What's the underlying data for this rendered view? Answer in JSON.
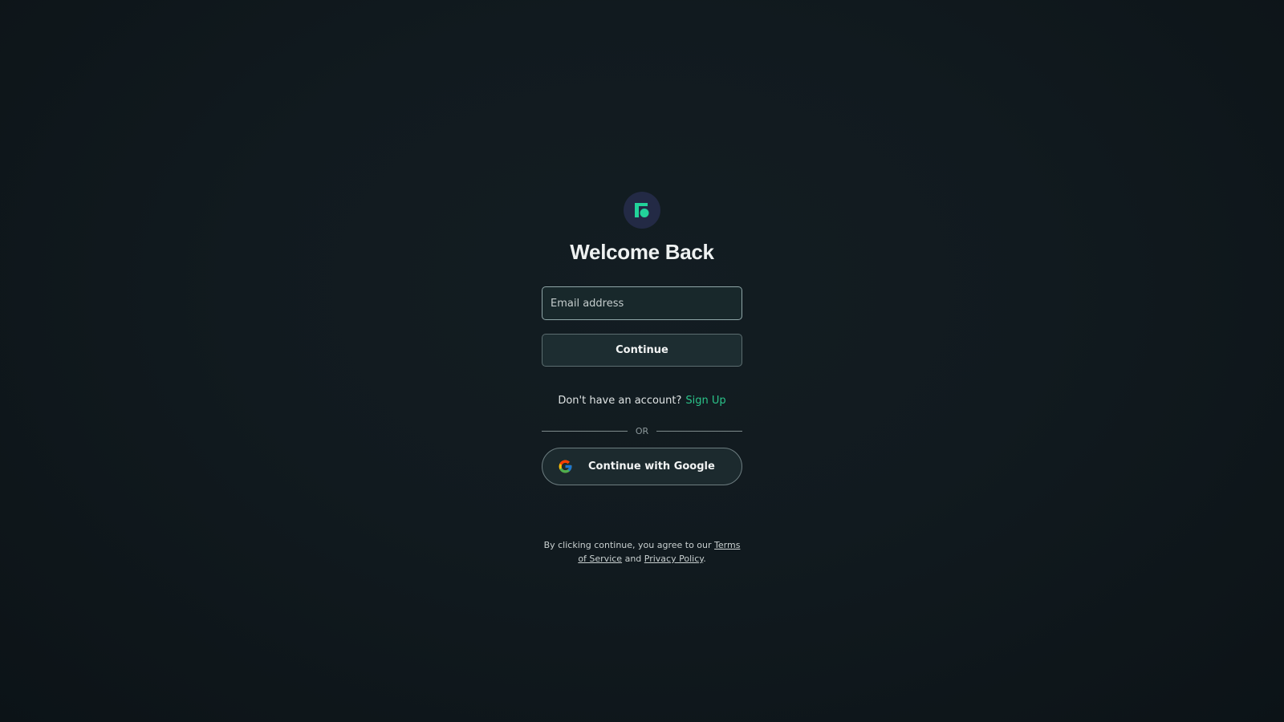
{
  "brand": {
    "logo_icon": "brand-logo-icon",
    "accent_color": "#22d39a"
  },
  "header": {
    "title": "Welcome Back"
  },
  "form": {
    "email_placeholder": "Email address",
    "email_value": "",
    "continue_label": "Continue"
  },
  "signup": {
    "prompt": "Don't have an account?",
    "link_label": "Sign Up"
  },
  "divider": {
    "label": "OR"
  },
  "oauth": {
    "google_label": "Continue with Google",
    "google_icon": "google-icon"
  },
  "legal": {
    "prefix": "By clicking continue, you agree to our",
    "terms_label": "Terms of Service",
    "and_text": "and",
    "privacy_label": "Privacy Policy",
    "suffix": "."
  }
}
